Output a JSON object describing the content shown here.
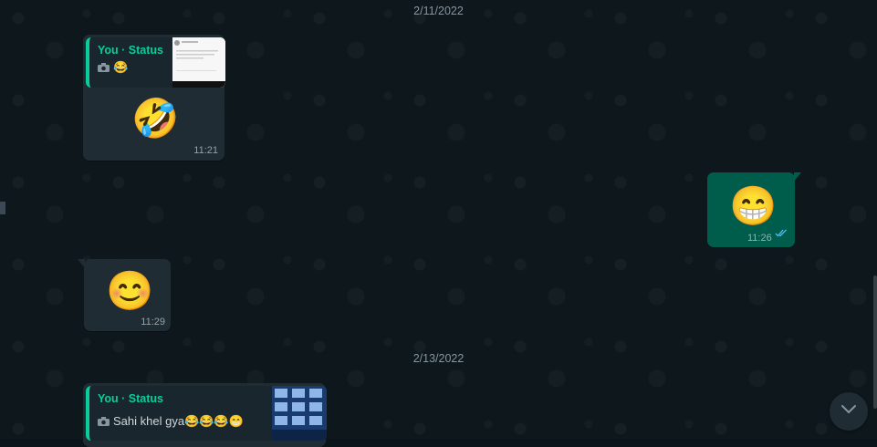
{
  "dates": [
    "2/11/2022",
    "2/13/2022"
  ],
  "messages": [
    {
      "quote_title": "You · Status",
      "quote_text": "😂",
      "emoji": "🤣",
      "time": "11:21"
    },
    {
      "emoji": "😁",
      "time": "11:26",
      "status": "read"
    },
    {
      "emoji": "😊",
      "time": "11:29"
    },
    {
      "quote_title": "You · Status",
      "quote_text": "Sahi khel gya😂😂😂😁"
    }
  ],
  "icons": {
    "camera": "camera-icon",
    "read_ticks": "double-check-icon",
    "scroll_down": "chevron-down-icon"
  },
  "colors": {
    "accent": "#06cf9c",
    "outgoing": "#005c4b",
    "incoming": "#1f2c33",
    "background": "#0b141a"
  }
}
